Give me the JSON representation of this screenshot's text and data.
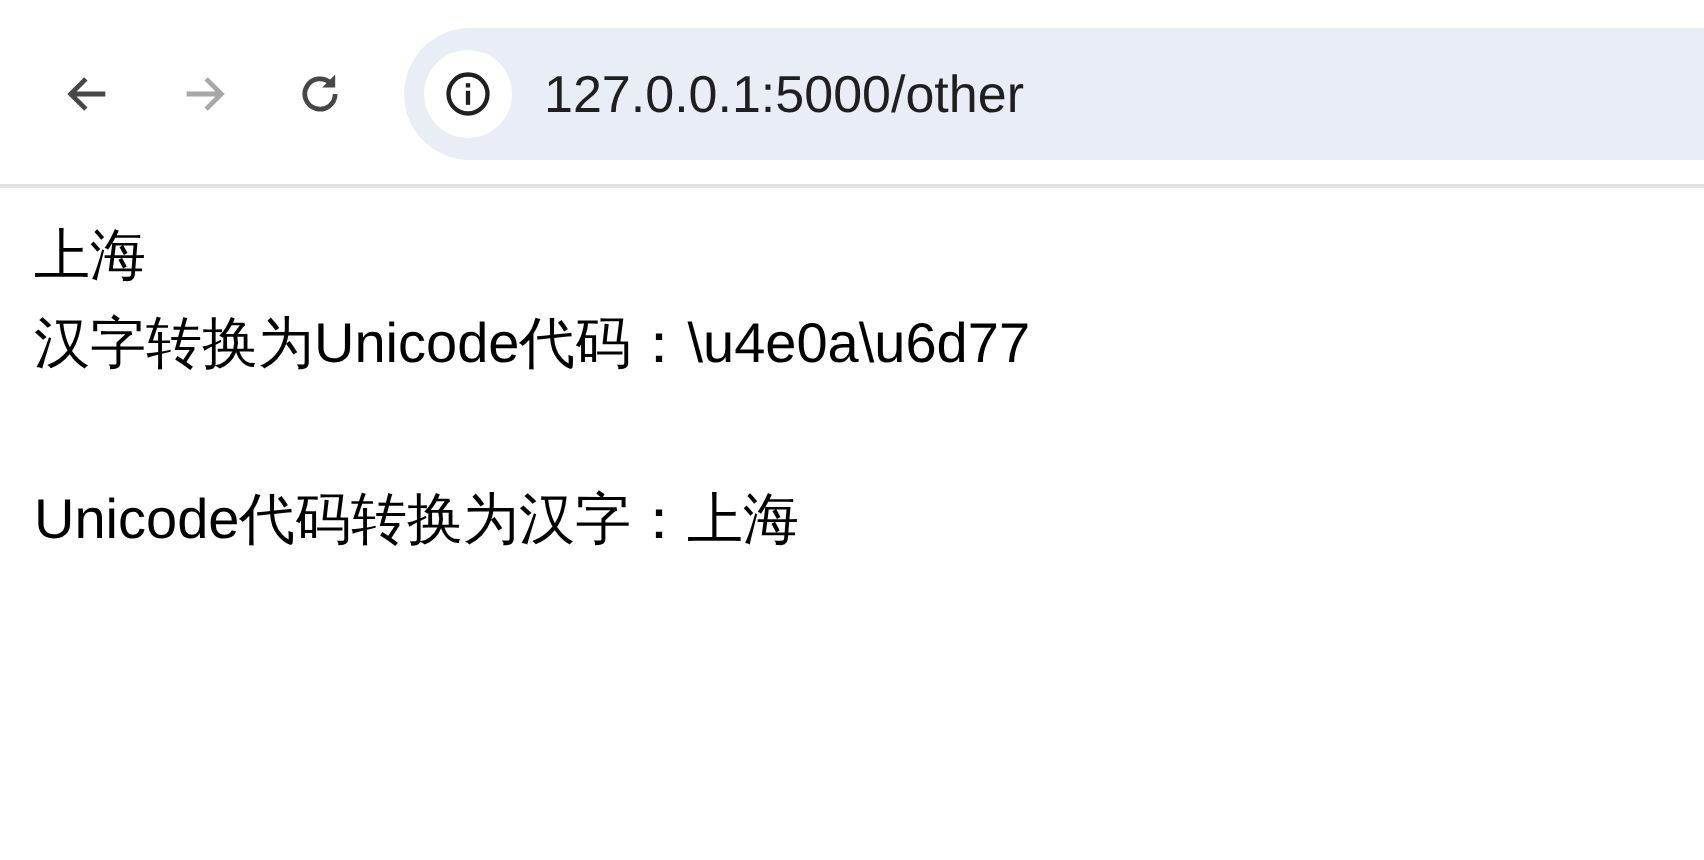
{
  "toolbar": {
    "buttons": [
      {
        "kind": "back",
        "disabled": false
      },
      {
        "kind": "forward",
        "disabled": true
      },
      {
        "kind": "reload",
        "disabled": false
      }
    ],
    "address": "127.0.0.1:5000/other"
  },
  "content": {
    "blocks": [
      [
        "上海",
        "汉字转换为Unicode代码：\\u4e0a\\u6d77"
      ],
      [
        "Unicode代码转换为汉字：上海"
      ]
    ]
  }
}
